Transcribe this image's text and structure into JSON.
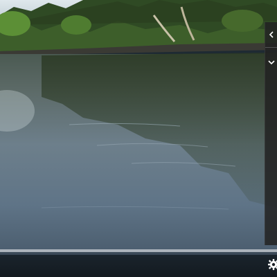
{
  "viewer": {
    "scene": "river-forest-photo"
  },
  "side_panel": {
    "collapse_icon": "chevron-left-icon",
    "expand_icon": "chevron-down-icon"
  },
  "controls": {
    "settings_icon": "gear-icon"
  },
  "colors": {
    "panel_bg": "#222222",
    "icon": "#ffffff",
    "timeline": "#cdd2d6"
  }
}
